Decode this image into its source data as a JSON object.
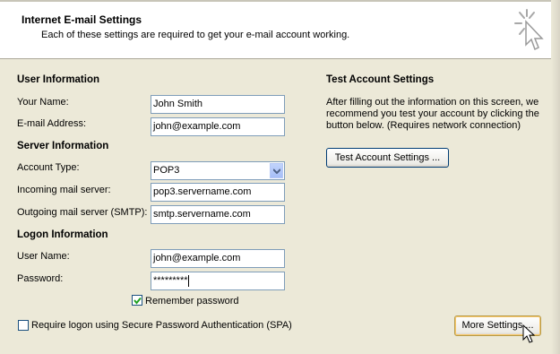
{
  "header": {
    "title": "Internet E-mail Settings",
    "subtitle": "Each of these settings are required to get your e-mail account working."
  },
  "user_info": {
    "heading": "User Information",
    "name_label": "Your Name:",
    "name_value": "John Smith",
    "email_label": "E-mail Address:",
    "email_value": "john@example.com"
  },
  "server_info": {
    "heading": "Server Information",
    "account_type_label": "Account Type:",
    "account_type_value": "POP3",
    "incoming_label": "Incoming mail server:",
    "incoming_value": "pop3.servername.com",
    "outgoing_label": "Outgoing mail server (SMTP):",
    "outgoing_value": "smtp.servername.com"
  },
  "logon_info": {
    "heading": "Logon Information",
    "username_label": "User Name:",
    "username_value": "john@example.com",
    "password_label": "Password:",
    "password_value": "*********",
    "remember_label": "Remember password",
    "remember_checked": true,
    "spa_label": "Require logon using Secure Password Authentication (SPA)",
    "spa_checked": false
  },
  "test": {
    "heading": "Test Account Settings",
    "description": "After filling out the information on this screen, we recommend you test your account by clicking the button below. (Requires network connection)",
    "button_label": "Test Account Settings ..."
  },
  "more_settings_label": "More Settings ..."
}
